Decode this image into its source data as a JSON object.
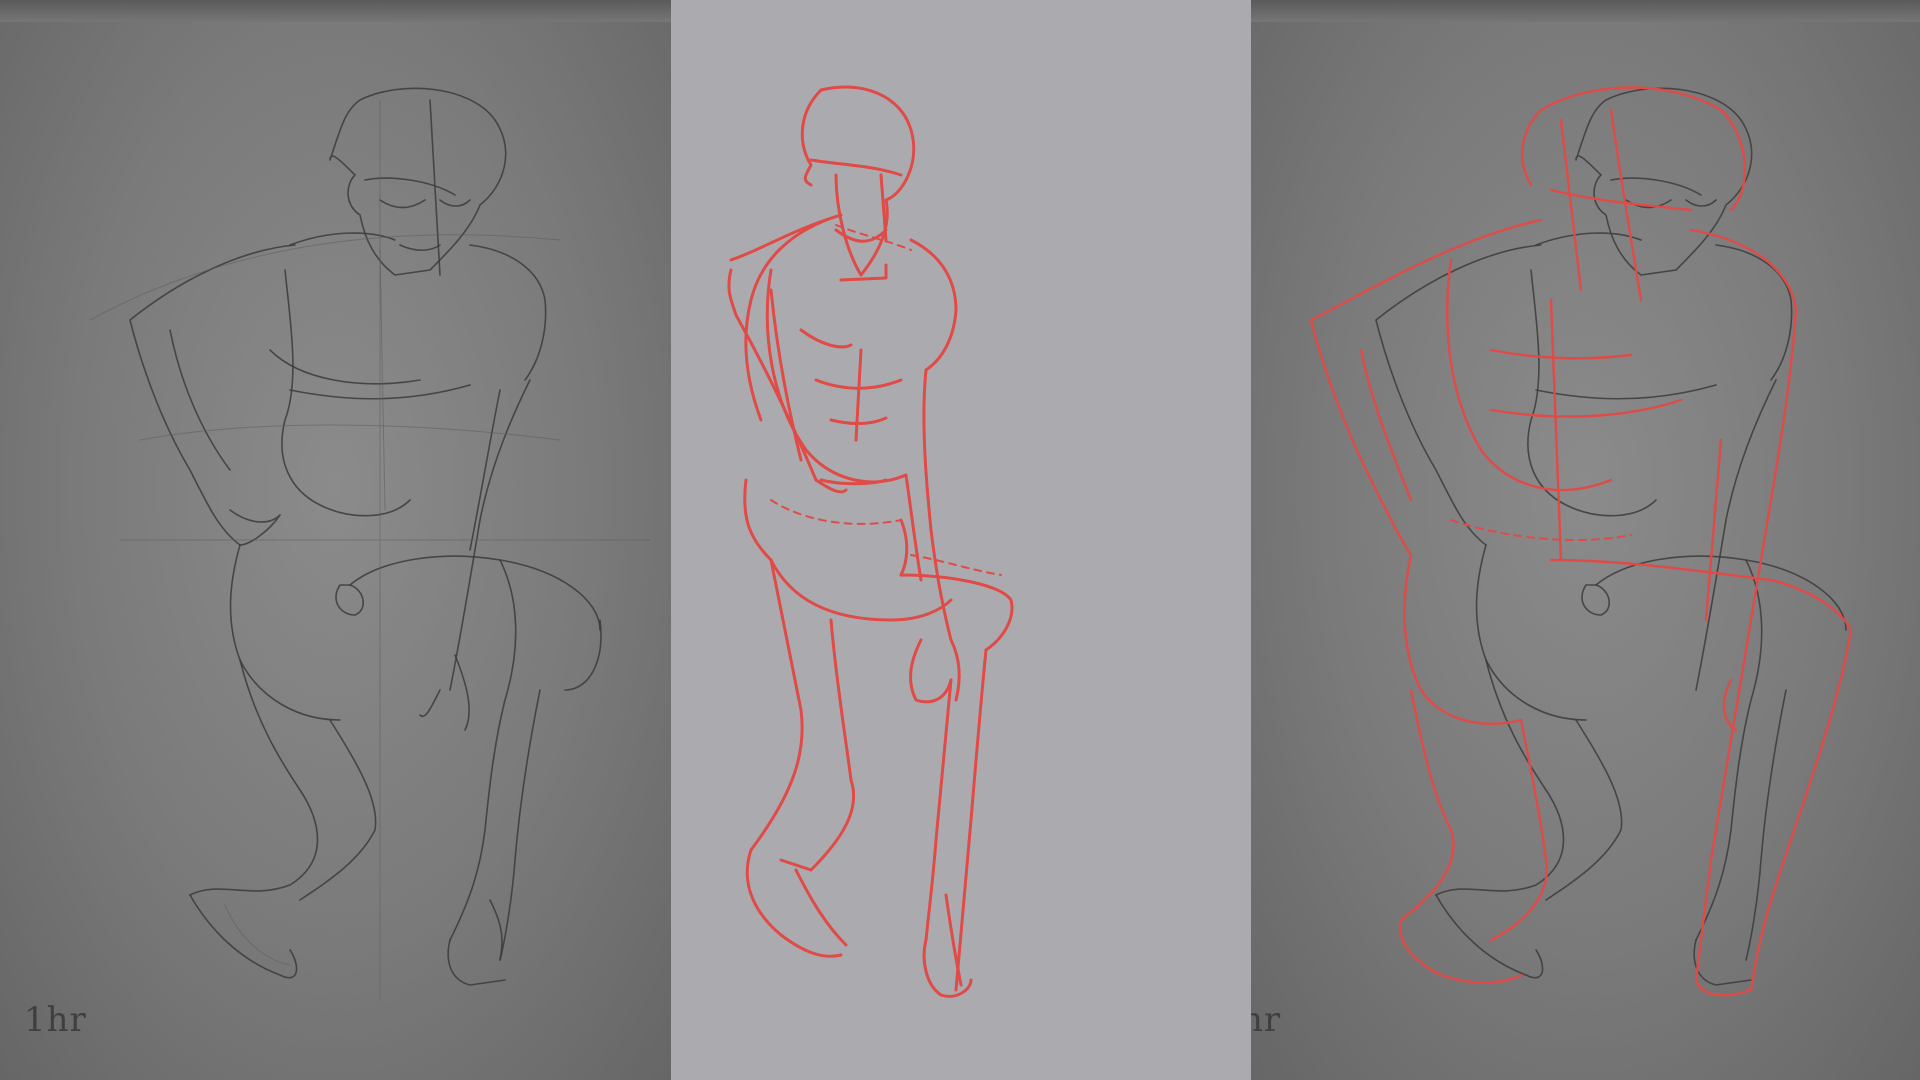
{
  "panels": {
    "left": {
      "caption": "1hr"
    },
    "middle": {
      "caption": ""
    },
    "right": {
      "caption": "hr"
    }
  },
  "colors": {
    "pencil": "#3b3b3b",
    "red_construction": "#e04a47",
    "middle_background": "#ababaf",
    "photo_background": "#7a7a7a"
  }
}
